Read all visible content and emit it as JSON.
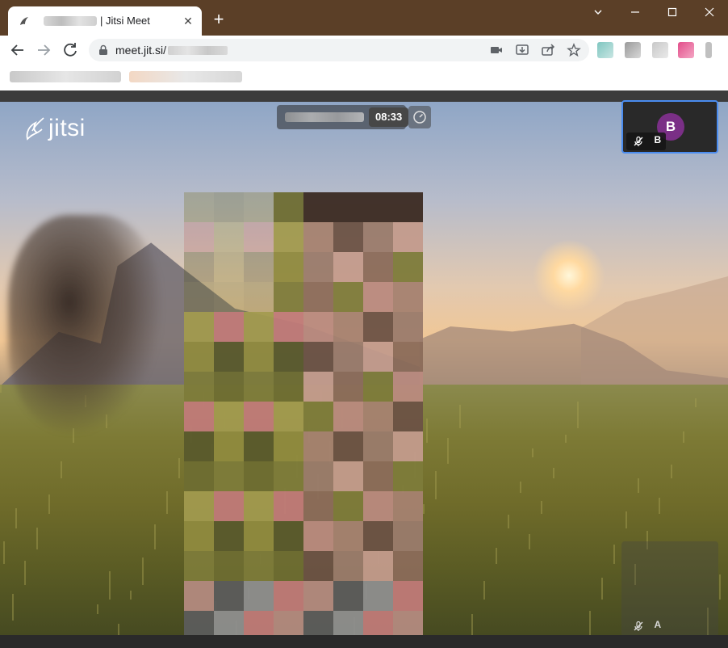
{
  "browser": {
    "tab": {
      "title": "| Jitsi Meet",
      "close_label": "✕"
    },
    "new_tab_label": "+",
    "address": {
      "host": "meet.jit.si/"
    },
    "colors": {
      "frame": "#5b3f27",
      "toolbar": "#ffffff",
      "omnibox": "#f1f3f4"
    }
  },
  "meeting": {
    "logo_text": "jitsi",
    "timer": "08:33",
    "participants": [
      {
        "initial": "B",
        "name_label": "B",
        "muted": true,
        "avatar_color": "#7a2f86",
        "active": true
      },
      {
        "initial": "A",
        "name_label": "A",
        "muted": true
      }
    ],
    "colors": {
      "active_border": "#4a8cef",
      "timer_bg": "#474747"
    }
  }
}
